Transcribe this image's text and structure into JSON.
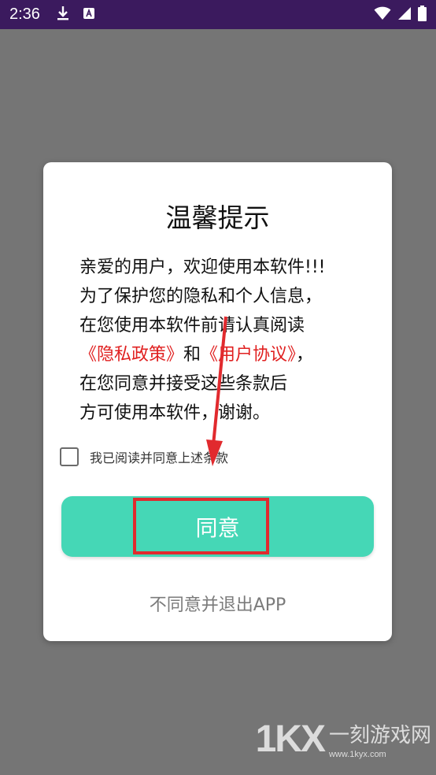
{
  "status_bar": {
    "time": "2:36",
    "icons": [
      "download-icon",
      "a-icon",
      "wifi-icon",
      "signal-icon",
      "battery-icon"
    ]
  },
  "dialog": {
    "title": "温馨提示",
    "lines": [
      {
        "text": "亲爱的用户，欢迎使用本软件!!!"
      },
      {
        "text": "为了保护您的隐私和个人信息，"
      },
      {
        "text": "在您使用本软件前请认真阅读"
      },
      {
        "privacy": "《隐私政策》",
        "and": "和",
        "agreement": "《用户协议》",
        "comma": "，"
      },
      {
        "text": "在您同意并接受这些条款后"
      },
      {
        "text": "方可使用本软件，谢谢。"
      }
    ],
    "checkbox_label": "我已阅读并同意上述条款",
    "agree_button": "同意",
    "exit_link": "不同意并退出APP"
  },
  "colors": {
    "status_bar": "#3b1a5e",
    "overlay": "#757575",
    "accent": "#45d7b6",
    "link_red": "#e02020",
    "annotation_red": "#e12a2e"
  },
  "watermark": {
    "logo": "1KX",
    "name": "一刻游戏网",
    "url": "www.1kyx.com"
  }
}
